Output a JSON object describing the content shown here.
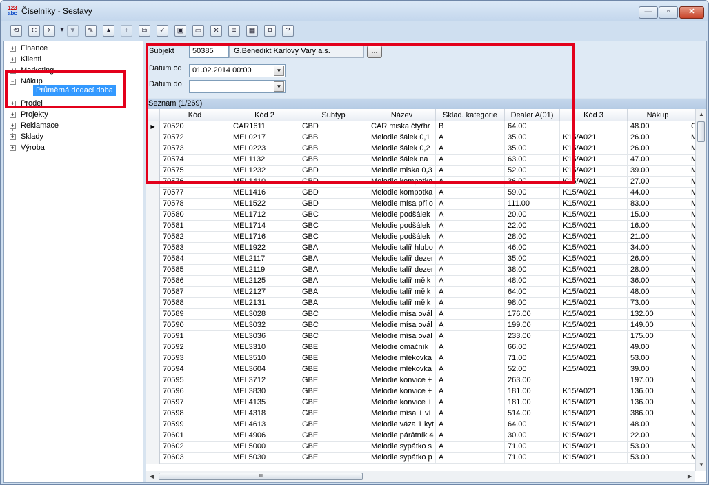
{
  "window": {
    "title": "Číselníky - Sestavy",
    "app_icon_top": "123",
    "app_icon_bottom": "abc",
    "minimize_glyph": "—",
    "maximize_glyph": "▫",
    "close_glyph": "✕"
  },
  "toolbar": {
    "icons": [
      {
        "name": "refresh-icon",
        "glyph": "⟲",
        "enabled": true
      },
      {
        "name": "copy-icon",
        "glyph": "C",
        "enabled": true
      },
      {
        "name": "report-icon",
        "glyph": "Σ",
        "enabled": true
      },
      {
        "name": "dropdown-arrow-icon",
        "glyph": "▾",
        "enabled": true
      },
      {
        "name": "filter-icon",
        "glyph": "▼",
        "enabled": false
      },
      {
        "name": "edit-icon",
        "glyph": "✎",
        "enabled": true
      },
      {
        "name": "record-up-icon",
        "glyph": "▲",
        "enabled": true
      },
      {
        "name": "record-new-icon",
        "glyph": "+",
        "enabled": false
      },
      {
        "name": "duplicate-icon",
        "glyph": "⧉",
        "enabled": true
      },
      {
        "name": "check-icon",
        "glyph": "✓",
        "enabled": true
      },
      {
        "name": "save-icon",
        "glyph": "▣",
        "enabled": true
      },
      {
        "name": "open-folder-icon",
        "glyph": "▭",
        "enabled": true
      },
      {
        "name": "delete-icon",
        "glyph": "✕",
        "enabled": true
      },
      {
        "name": "list-view-icon",
        "glyph": "≡",
        "enabled": true
      },
      {
        "name": "grid-view-icon",
        "glyph": "▦",
        "enabled": true
      },
      {
        "name": "tools-icon",
        "glyph": "⚙",
        "enabled": true
      },
      {
        "name": "help-icon",
        "glyph": "?",
        "enabled": true
      }
    ]
  },
  "tree": {
    "items": [
      {
        "label": "Finance",
        "toggle": "+"
      },
      {
        "label": "Klienti",
        "toggle": "+"
      },
      {
        "label": "Marketing",
        "toggle": "+"
      },
      {
        "label": "Nákup",
        "toggle": "−"
      },
      {
        "label": "Prodej",
        "toggle": "+"
      },
      {
        "label": "Projekty",
        "toggle": "+"
      },
      {
        "label": "Reklamace",
        "toggle": "+"
      },
      {
        "label": "Sklady",
        "toggle": "+"
      },
      {
        "label": "Výroba",
        "toggle": "+"
      }
    ],
    "selected_child": "Průměrná dodací doba"
  },
  "filter": {
    "subject_label": "Subjekt",
    "subject_code": "50385",
    "subject_name": "G.Benedikt Karlovy Vary a.s.",
    "browse_label": "...",
    "date_from_label": "Datum od",
    "date_from_value": "01.02.2014 00:00",
    "date_to_label": "Datum do",
    "date_to_value": "",
    "dropdown_glyph": "▼"
  },
  "list": {
    "caption": "Seznam (1/269)",
    "current_row_marker": "▶",
    "columns": [
      "Kód",
      "Kód 2",
      "Subtyp",
      "Název",
      "Sklad. kategorie",
      "Dealer A(01)",
      "Kód 3",
      "Nákup",
      ""
    ],
    "rows": [
      [
        "70520",
        "CAR1611",
        "GBD",
        "CAR miska čtyřhr",
        "B",
        "64.00",
        "",
        "48.00",
        "C"
      ],
      [
        "70572",
        "MEL0217",
        "GBB",
        "Melodie šálek 0,1",
        "A",
        "35.00",
        "K15/A021",
        "26.00",
        "M"
      ],
      [
        "70573",
        "MEL0223",
        "GBB",
        "Melodie šálek 0,2",
        "A",
        "35.00",
        "K15/A021",
        "26.00",
        "M"
      ],
      [
        "70574",
        "MEL1132",
        "GBB",
        "Melodie šálek na",
        "A",
        "63.00",
        "K15/A021",
        "47.00",
        "M"
      ],
      [
        "70575",
        "MEL1232",
        "GBD",
        "Melodie miska 0,3",
        "A",
        "52.00",
        "K15/A021",
        "39.00",
        "M"
      ],
      [
        "70576",
        "MEL1410",
        "GBD",
        "Melodie kompotka",
        "A",
        "36.00",
        "K15/A021",
        "27.00",
        "M"
      ],
      [
        "70577",
        "MEL1416",
        "GBD",
        "Melodie kompotka",
        "A",
        "59.00",
        "K15/A021",
        "44.00",
        "M"
      ],
      [
        "70578",
        "MEL1522",
        "GBD",
        "Melodie mísa přílo",
        "A",
        "111.00",
        "K15/A021",
        "83.00",
        "M"
      ],
      [
        "70580",
        "MEL1712",
        "GBC",
        "Melodie podšálek",
        "A",
        "20.00",
        "K15/A021",
        "15.00",
        "M"
      ],
      [
        "70581",
        "MEL1714",
        "GBC",
        "Melodie podšálek",
        "A",
        "22.00",
        "K15/A021",
        "16.00",
        "M"
      ],
      [
        "70582",
        "MEL1716",
        "GBC",
        "Melodie podšálek",
        "A",
        "28.00",
        "K15/A021",
        "21.00",
        "M"
      ],
      [
        "70583",
        "MEL1922",
        "GBA",
        "Melodie talíř hlubo",
        "A",
        "46.00",
        "K15/A021",
        "34.00",
        "M"
      ],
      [
        "70584",
        "MEL2117",
        "GBA",
        "Melodie talíř dezer",
        "A",
        "35.00",
        "K15/A021",
        "26.00",
        "M"
      ],
      [
        "70585",
        "MEL2119",
        "GBA",
        "Melodie talíř dezer",
        "A",
        "38.00",
        "K15/A021",
        "28.00",
        "M"
      ],
      [
        "70586",
        "MEL2125",
        "GBA",
        "Melodie talíř mělk",
        "A",
        "48.00",
        "K15/A021",
        "36.00",
        "M"
      ],
      [
        "70587",
        "MEL2127",
        "GBA",
        "Melodie talíř mělk",
        "A",
        "64.00",
        "K15/A021",
        "48.00",
        "M"
      ],
      [
        "70588",
        "MEL2131",
        "GBA",
        "Melodie talíř mělk",
        "A",
        "98.00",
        "K15/A021",
        "73.00",
        "M"
      ],
      [
        "70589",
        "MEL3028",
        "GBC",
        "Melodie mísa ovál",
        "A",
        "176.00",
        "K15/A021",
        "132.00",
        "M"
      ],
      [
        "70590",
        "MEL3032",
        "GBC",
        "Melodie mísa ovál",
        "A",
        "199.00",
        "K15/A021",
        "149.00",
        "M"
      ],
      [
        "70591",
        "MEL3036",
        "GBC",
        "Melodie mísa ovál",
        "A",
        "233.00",
        "K15/A021",
        "175.00",
        "M"
      ],
      [
        "70592",
        "MEL3310",
        "GBE",
        "Melodie omáčník",
        "A",
        "66.00",
        "K15/A021",
        "49.00",
        "M"
      ],
      [
        "70593",
        "MEL3510",
        "GBE",
        "Melodie mlékovka",
        "A",
        "71.00",
        "K15/A021",
        "53.00",
        "M"
      ],
      [
        "70594",
        "MEL3604",
        "GBE",
        "Melodie mlékovka",
        "A",
        "52.00",
        "K15/A021",
        "39.00",
        "M"
      ],
      [
        "70595",
        "MEL3712",
        "GBE",
        "Melodie konvice +",
        "A",
        "263.00",
        "",
        "197.00",
        "M"
      ],
      [
        "70596",
        "MEL3830",
        "GBE",
        "Melodie konvice +",
        "A",
        "181.00",
        "K15/A021",
        "136.00",
        "M"
      ],
      [
        "70597",
        "MEL4135",
        "GBE",
        "Melodie konvice +",
        "A",
        "181.00",
        "K15/A021",
        "136.00",
        "M"
      ],
      [
        "70598",
        "MEL4318",
        "GBE",
        "Melodie mísa + ví",
        "A",
        "514.00",
        "K15/A021",
        "386.00",
        "M"
      ],
      [
        "70599",
        "MEL4613",
        "GBE",
        "Melodie váza 1 kyt",
        "A",
        "64.00",
        "K15/A021",
        "48.00",
        "M"
      ],
      [
        "70601",
        "MEL4906",
        "GBE",
        "Melodie párátník 4",
        "A",
        "30.00",
        "K15/A021",
        "22.00",
        "M"
      ],
      [
        "70602",
        "MEL5000",
        "GBE",
        "Melodie sypátko s",
        "A",
        "71.00",
        "K15/A021",
        "53.00",
        "M"
      ],
      [
        "70603",
        "MEL5030",
        "GBE",
        "Melodie sypátko p",
        "A",
        "71.00",
        "K15/A021",
        "53.00",
        "M"
      ]
    ],
    "scroll_up_glyph": "▲",
    "scroll_down_glyph": "▼",
    "scroll_left_glyph": "◀",
    "scroll_right_glyph": "▶",
    "hthumb_grip": "III"
  },
  "colors": {
    "highlight": "#e3001b",
    "selection": "#3399ff"
  }
}
